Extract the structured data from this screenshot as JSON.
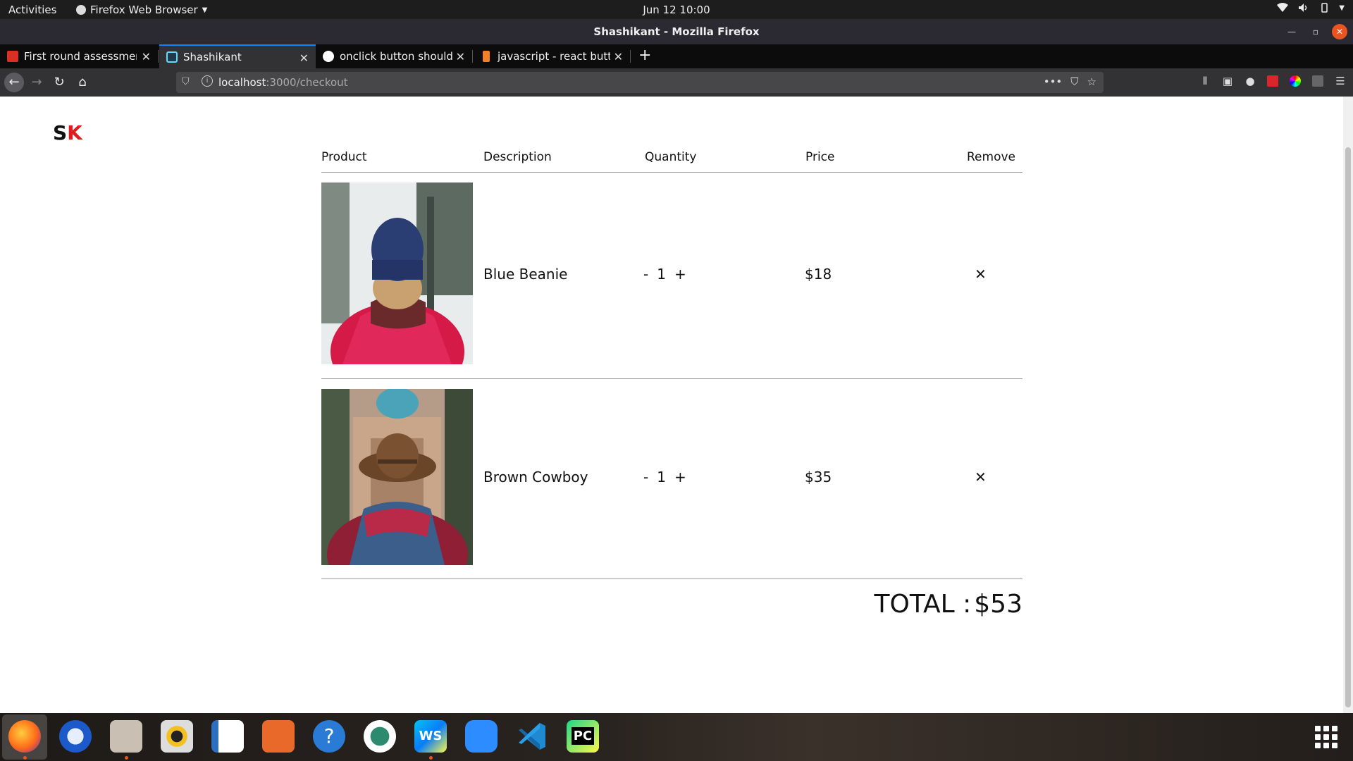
{
  "system_bar": {
    "activities": "Activities",
    "app_menu": "Firefox Web Browser",
    "clock": "Jun 12  10:00"
  },
  "window": {
    "title": "Shashikant - Mozilla Firefox"
  },
  "tabs": [
    {
      "label": "First round assessment -",
      "favicon": "gmail-icon",
      "color": "#d93025"
    },
    {
      "label": "Shashikant",
      "favicon": "react-icon",
      "color": "#61dafb",
      "active": true
    },
    {
      "label": "onclick button should re",
      "favicon": "google-icon",
      "color": "#ffffff"
    },
    {
      "label": "javascript - react button",
      "favicon": "stackoverflow-icon",
      "color": "#f48024"
    }
  ],
  "urlbar": {
    "host": "localhost",
    "path": ":3000/checkout"
  },
  "page": {
    "logo_s": "S",
    "logo_k": "K",
    "headers": {
      "product": "Product",
      "description": "Description",
      "quantity": "Quantity",
      "price": "Price",
      "remove": "Remove"
    },
    "items": [
      {
        "description": "Blue Beanie",
        "minus": "-",
        "quantity": "1",
        "plus": "+",
        "price": "$18",
        "remove": "✕"
      },
      {
        "description": "Brown Cowboy",
        "minus": "-",
        "quantity": "1",
        "plus": "+",
        "price": "$35",
        "remove": "✕"
      }
    ],
    "total_label": "TOTAL :",
    "total_value": "$53"
  },
  "dock": {
    "apps": [
      "firefox-icon",
      "thunderbird-icon",
      "files-icon",
      "rhythmbox-icon",
      "writer-icon",
      "software-icon",
      "help-icon",
      "remmina-icon",
      "webstorm-icon",
      "zoom-icon",
      "vscode-icon",
      "pycharm-icon"
    ]
  }
}
